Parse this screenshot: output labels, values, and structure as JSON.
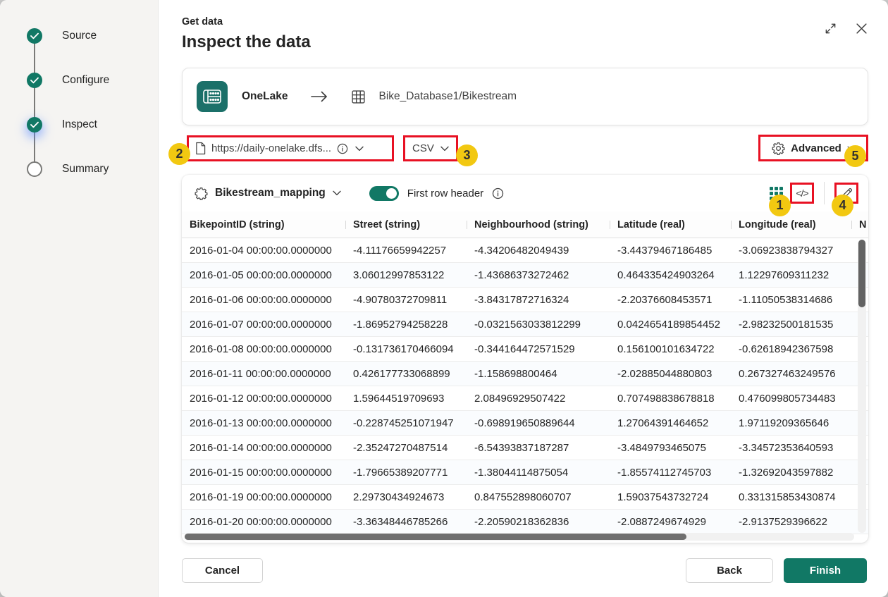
{
  "colors": {
    "accent": "#117865",
    "annotation_red": "#E81123",
    "callout_yellow": "#F2C811"
  },
  "dialog": {
    "eyebrow": "Get data",
    "title": "Inspect the data"
  },
  "stepper": {
    "items": [
      {
        "label": "Source",
        "state": "done"
      },
      {
        "label": "Configure",
        "state": "done"
      },
      {
        "label": "Inspect",
        "state": "active"
      },
      {
        "label": "Summary",
        "state": "todo"
      }
    ]
  },
  "source_card": {
    "source_label": "OneLake",
    "destination": "Bike_Database1/Bikestream"
  },
  "controls": {
    "url_value": "https://daily-onelake.dfs...",
    "format_value": "CSV",
    "advanced_label": "Advanced"
  },
  "mapping_bar": {
    "mapping_name": "Bikestream_mapping",
    "toggle_label": "First row header",
    "toggle_state": "on",
    "code_view_label": "</>"
  },
  "callouts": [
    "1",
    "2",
    "3",
    "4",
    "5"
  ],
  "table": {
    "columns": [
      "BikepointID (string)",
      "Street (string)",
      "Neighbourhood (string)",
      "Latitude (real)",
      "Longitude (real)",
      "N"
    ],
    "rows": [
      [
        "2016-01-04 00:00:00.0000000",
        "-4.11176659942257",
        "-4.34206482049439",
        "-3.44379467186485",
        "-3.06923838794327"
      ],
      [
        "2016-01-05 00:00:00.0000000",
        "3.06012997853122",
        "-1.43686373272462",
        "0.464335424903264",
        "1.12297609311232"
      ],
      [
        "2016-01-06 00:00:00.0000000",
        "-4.90780372709811",
        "-3.84317872716324",
        "-2.20376608453571",
        "-1.11050538314686"
      ],
      [
        "2016-01-07 00:00:00.0000000",
        "-1.86952794258228",
        "-0.0321563033812299",
        "0.0424654189854452",
        "-2.98232500181535"
      ],
      [
        "2016-01-08 00:00:00.0000000",
        "-0.131736170466094",
        "-0.344164472571529",
        "0.156100101634722",
        "-0.62618942367598"
      ],
      [
        "2016-01-11 00:00:00.0000000",
        "0.426177733068899",
        "-1.158698800464",
        "-2.02885044880803",
        "0.267327463249576"
      ],
      [
        "2016-01-12 00:00:00.0000000",
        "1.59644519709693",
        "2.08496929507422",
        "0.707498838678818",
        "0.476099805734483"
      ],
      [
        "2016-01-13 00:00:00.0000000",
        "-0.228745251071947",
        "-0.698919650889644",
        "1.27064391464652",
        "1.97119209365646"
      ],
      [
        "2016-01-14 00:00:00.0000000",
        "-2.35247270487514",
        "-6.54393837187287",
        "-3.4849793465075",
        "-3.34572353640593"
      ],
      [
        "2016-01-15 00:00:00.0000000",
        "-1.79665389207771",
        "-1.38044114875054",
        "-1.85574112745703",
        "-1.32692043597882"
      ],
      [
        "2016-01-19 00:00:00.0000000",
        "2.29730434924673",
        "0.847552898060707",
        "1.59037543732724",
        "0.331315853430874"
      ],
      [
        "2016-01-20 00:00:00.0000000",
        "-3.36348446785266",
        "-2.20590218362836",
        "-2.0887249674929",
        "-2.9137529396622"
      ]
    ]
  },
  "footer": {
    "cancel_label": "Cancel",
    "back_label": "Back",
    "finish_label": "Finish"
  }
}
